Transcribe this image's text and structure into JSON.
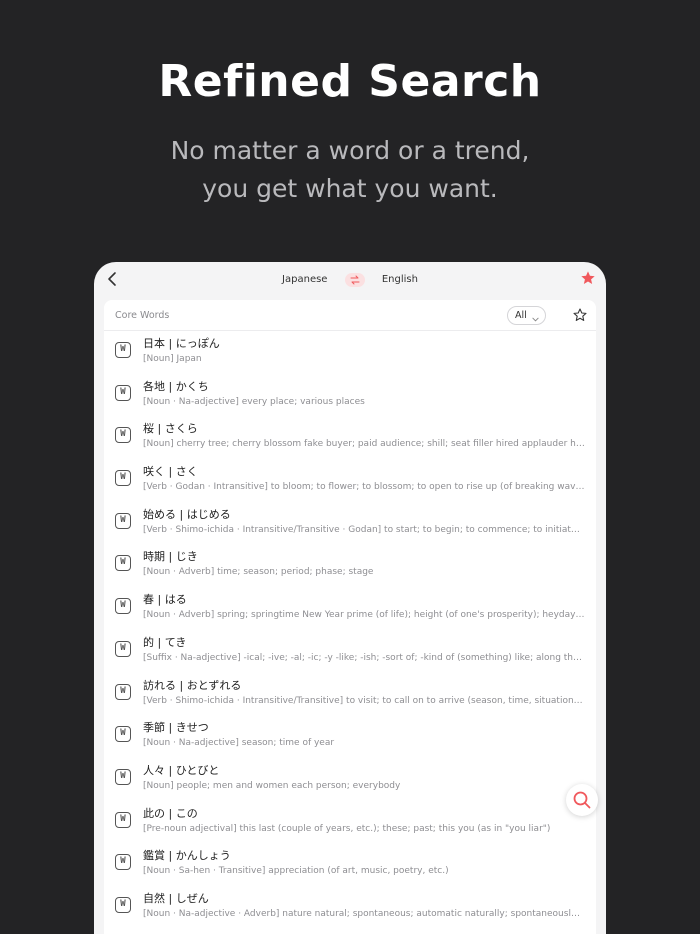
{
  "hero": {
    "title": "Refined Search",
    "subtitle_line1": "No matter a word or a trend,",
    "subtitle_line2": "you get what you want."
  },
  "nav": {
    "source_lang": "Japanese",
    "target_lang": "English"
  },
  "section": {
    "title": "Core Words",
    "filter": "All"
  },
  "entry_icon_label": "W",
  "colors": {
    "accent": "#f0585c",
    "background": "#232325"
  },
  "entries": [
    {
      "word": "日本 | にっぽん",
      "meaning": "[Noun] Japan"
    },
    {
      "word": "各地 | かくち",
      "meaning": "[Noun · Na-adjective] every place; various places"
    },
    {
      "word": "桜 | さくら",
      "meaning": "[Noun] cherry tree; cherry blossom fake buyer; paid audience; shill; seat filler hired applauder horse..."
    },
    {
      "word": "咲く | さく",
      "meaning": "[Verb · Godan · Intransitive] to bloom; to flower; to blossom; to open to rise up (of breaking waves)"
    },
    {
      "word": "始める | はじめる",
      "meaning": "[Verb · Shimo-ichida · Intransitive/Transitive · Godan] to start; to begin; to commence; to initiate; t..."
    },
    {
      "word": "時期 | じき",
      "meaning": "[Noun · Adverb] time; season; period; phase; stage"
    },
    {
      "word": "春 | はる",
      "meaning": "[Noun · Adverb] spring; springtime New Year prime (of life); height (of one's prosperity); heyday ado..."
    },
    {
      "word": "的 | てき",
      "meaning": "[Suffix · Na-adjective] -ical; -ive; -al; -ic; -y -like; -ish; -sort of; -kind of (something) like; along the li..."
    },
    {
      "word": "訪れる | おとずれる",
      "meaning": "[Verb · Shimo-ichida · Intransitive/Transitive] to visit; to call on to arrive (season, time, situation, etc..."
    },
    {
      "word": "季節 | きせつ",
      "meaning": "[Noun · Na-adjective] season; time of year"
    },
    {
      "word": "人々 | ひとびと",
      "meaning": "[Noun] people; men and women each person; everybody"
    },
    {
      "word": "此の | この",
      "meaning": "[Pre-noun adjectival] this last (couple of years, etc.); these; past; this you (as in \"you liar\")"
    },
    {
      "word": "鑑賞 | かんしょう",
      "meaning": "[Noun · Sa-hen · Transitive] appreciation (of art, music, poetry, etc.)"
    },
    {
      "word": "自然 | しぜん",
      "meaning": "[Noun · Na-adjective · Adverb] nature natural; spontaneous; automatic naturally; spontaneously; au..."
    }
  ]
}
